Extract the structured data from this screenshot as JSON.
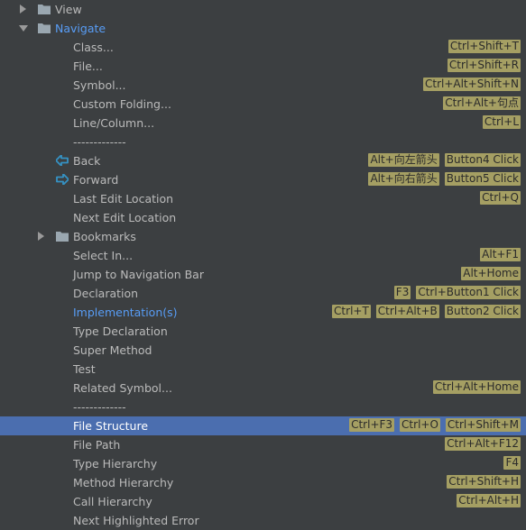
{
  "tree": {
    "view_label": "View",
    "navigate_label": "Navigate",
    "items": [
      {
        "label": "Class...",
        "shortcuts": [
          "Ctrl+Shift+T"
        ]
      },
      {
        "label": "File...",
        "shortcuts": [
          "Ctrl+Shift+R"
        ]
      },
      {
        "label": "Symbol...",
        "shortcuts": [
          "Ctrl+Alt+Shift+N"
        ]
      },
      {
        "label": "Custom Folding...",
        "shortcuts": [
          "Ctrl+Alt+句点"
        ]
      },
      {
        "label": "Line/Column...",
        "shortcuts": [
          "Ctrl+L"
        ]
      },
      {
        "label": "-------------",
        "shortcuts": []
      },
      {
        "label": "Back",
        "shortcuts": [
          "Alt+向左箭头",
          "Button4 Click"
        ]
      },
      {
        "label": "Forward",
        "shortcuts": [
          "Alt+向右箭头",
          "Button5 Click"
        ]
      },
      {
        "label": "Last Edit Location",
        "shortcuts": [
          "Ctrl+Q"
        ]
      },
      {
        "label": "Next Edit Location",
        "shortcuts": []
      },
      {
        "label": "Bookmarks",
        "shortcuts": []
      },
      {
        "label": "Select In...",
        "shortcuts": [
          "Alt+F1"
        ]
      },
      {
        "label": "Jump to Navigation Bar",
        "shortcuts": [
          "Alt+Home"
        ]
      },
      {
        "label": "Declaration",
        "shortcuts": [
          "F3",
          "Ctrl+Button1 Click"
        ]
      },
      {
        "label": "Implementation(s)",
        "shortcuts": [
          "Ctrl+T",
          "Ctrl+Alt+B",
          "Button2 Click"
        ]
      },
      {
        "label": "Type Declaration",
        "shortcuts": []
      },
      {
        "label": "Super Method",
        "shortcuts": []
      },
      {
        "label": "Test",
        "shortcuts": []
      },
      {
        "label": "Related Symbol...",
        "shortcuts": [
          "Ctrl+Alt+Home"
        ]
      },
      {
        "label": "-------------",
        "shortcuts": []
      },
      {
        "label": "File Structure",
        "shortcuts": [
          "Ctrl+F3",
          "Ctrl+O",
          "Ctrl+Shift+M"
        ]
      },
      {
        "label": "File Path",
        "shortcuts": [
          "Ctrl+Alt+F12"
        ]
      },
      {
        "label": "Type Hierarchy",
        "shortcuts": [
          "F4"
        ]
      },
      {
        "label": "Method Hierarchy",
        "shortcuts": [
          "Ctrl+Shift+H"
        ]
      },
      {
        "label": "Call Hierarchy",
        "shortcuts": [
          "Ctrl+Alt+H"
        ]
      },
      {
        "label": "Next Highlighted Error",
        "shortcuts": []
      }
    ],
    "selected_label": "File Structure",
    "modified_label": "Implementation(s)",
    "colors": {
      "background": "#3c3f41",
      "selection": "#4b6eaf",
      "modified_text": "#589df6",
      "shortcut_badge": "#a59f63",
      "nav_arrow": "#3592c4"
    },
    "icons": {
      "expand_collapsed": "triangle-right-icon",
      "expand_open": "triangle-down-icon",
      "group": "folder-icon",
      "back": "back-arrow-icon",
      "forward": "forward-arrow-icon"
    }
  }
}
